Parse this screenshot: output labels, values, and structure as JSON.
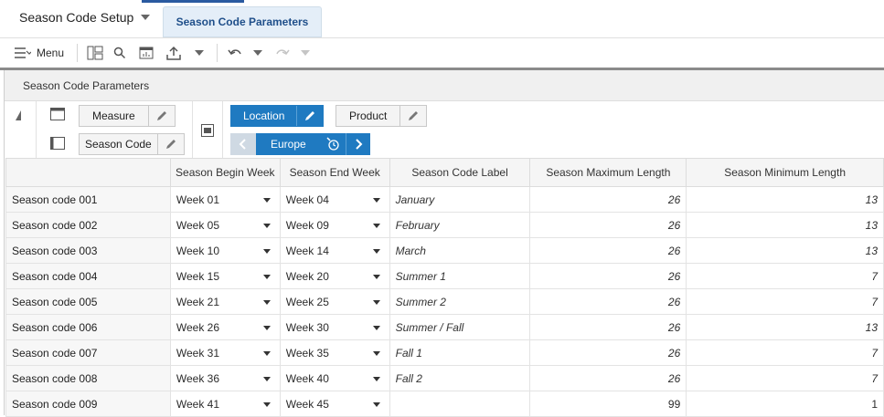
{
  "header": {
    "app_title": "Season Code Setup",
    "active_tab": "Season Code Parameters"
  },
  "toolbar": {
    "menu_label": "Menu"
  },
  "panel": {
    "title": "Season Code Parameters"
  },
  "pivot": {
    "row_dims": [
      "Measure",
      "Season Code"
    ],
    "col_dims": [
      "Location",
      "Product"
    ],
    "location_value": "Europe"
  },
  "grid": {
    "columns": [
      "Season Begin Week",
      "Season End Week",
      "Season Code Label",
      "Season Maximum Length",
      "Season Minimum Length"
    ],
    "rows": [
      {
        "code": "Season code 001",
        "begin": "Week 01",
        "end": "Week 04",
        "label": "January",
        "max": "26",
        "min": "13"
      },
      {
        "code": "Season code 002",
        "begin": "Week 05",
        "end": "Week 09",
        "label": "February",
        "max": "26",
        "min": "13"
      },
      {
        "code": "Season code 003",
        "begin": "Week 10",
        "end": "Week 14",
        "label": "March",
        "max": "26",
        "min": "13"
      },
      {
        "code": "Season code 004",
        "begin": "Week 15",
        "end": "Week 20",
        "label": "Summer 1",
        "max": "26",
        "min": "7"
      },
      {
        "code": "Season code 005",
        "begin": "Week 21",
        "end": "Week 25",
        "label": "Summer 2",
        "max": "26",
        "min": "7"
      },
      {
        "code": "Season code 006",
        "begin": "Week 26",
        "end": "Week 30",
        "label": "Summer / Fall",
        "max": "26",
        "min": "13"
      },
      {
        "code": "Season code 007",
        "begin": "Week 31",
        "end": "Week 35",
        "label": "Fall 1",
        "max": "26",
        "min": "7"
      },
      {
        "code": "Season code 008",
        "begin": "Week 36",
        "end": "Week 40",
        "label": "Fall 2",
        "max": "26",
        "min": "7"
      },
      {
        "code": "Season code 009",
        "begin": "Week 41",
        "end": "Week 45",
        "label": "",
        "max": "99",
        "min": "1"
      }
    ]
  },
  "colors": {
    "accent": "#1f7ac1",
    "tab_bg": "#e4eef8",
    "tab_text": "#1f4f8a"
  }
}
